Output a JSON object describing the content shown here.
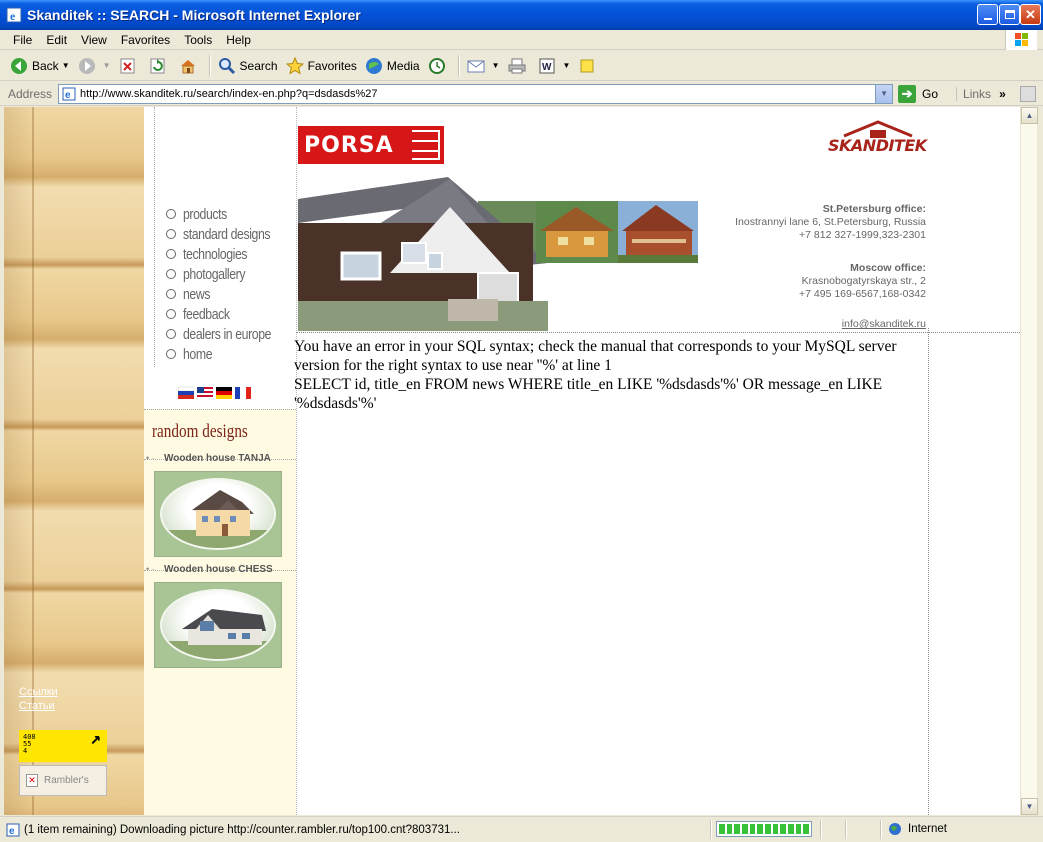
{
  "window": {
    "title": "Skanditek :: SEARCH - Microsoft Internet Explorer"
  },
  "menu": [
    "File",
    "Edit",
    "View",
    "Favorites",
    "Tools",
    "Help"
  ],
  "toolbar": {
    "back_label": "Back",
    "search_label": "Search",
    "favorites_label": "Favorites",
    "media_label": "Media"
  },
  "address": {
    "label": "Address",
    "url": "http://www.skanditek.ru/search/index-en.php?q=dsdasds%27",
    "go_label": "Go",
    "links_label": "Links"
  },
  "site": {
    "porsa_logo": "PORSA",
    "skanditek_logo": "SKANDITEK",
    "nav": [
      "products",
      "standard designs",
      "technologies",
      "photogallery",
      "news",
      "feedback",
      "dealers in europe",
      "home"
    ],
    "random_title": "random designs",
    "random_items": [
      "Wooden house TANJA",
      "Wooden house CHESS"
    ],
    "spb_office_title": "St.Petersburg office:",
    "spb_office_address": "Inostrannyi lane 6, St.Petersburg, Russia",
    "spb_office_phone": "+7 812 327-1999,323-2301",
    "msk_office_title": "Moscow office:",
    "msk_office_address": "Krasnobogatyrskaya str., 2",
    "msk_office_phone": "+7 495 169-6567,168-0342",
    "email": "info@skanditek.ru",
    "error_line1": "You have an error in your SQL syntax; check the manual that corresponds to your MySQL server version for the right syntax to use near ''%' at line 1",
    "error_line2": "SELECT id, title_en FROM news WHERE title_en LIKE '%dsdasds'%' OR message_en LIKE '%dsdasds'%'",
    "wood_links": [
      "Ссылки",
      "Статьи"
    ],
    "counter_digits": "408\n55\n4",
    "rambler_label": "Rambler's"
  },
  "status": {
    "text": "(1 item remaining) Downloading picture http://counter.rambler.ru/top100.cnt?803731...",
    "progress_blocks": 12,
    "zone": "Internet"
  },
  "colors": {
    "titlebar": "#0451d8",
    "porsa_red": "#d71717",
    "brand_red": "#a8231a",
    "random_title": "#7b2418"
  }
}
